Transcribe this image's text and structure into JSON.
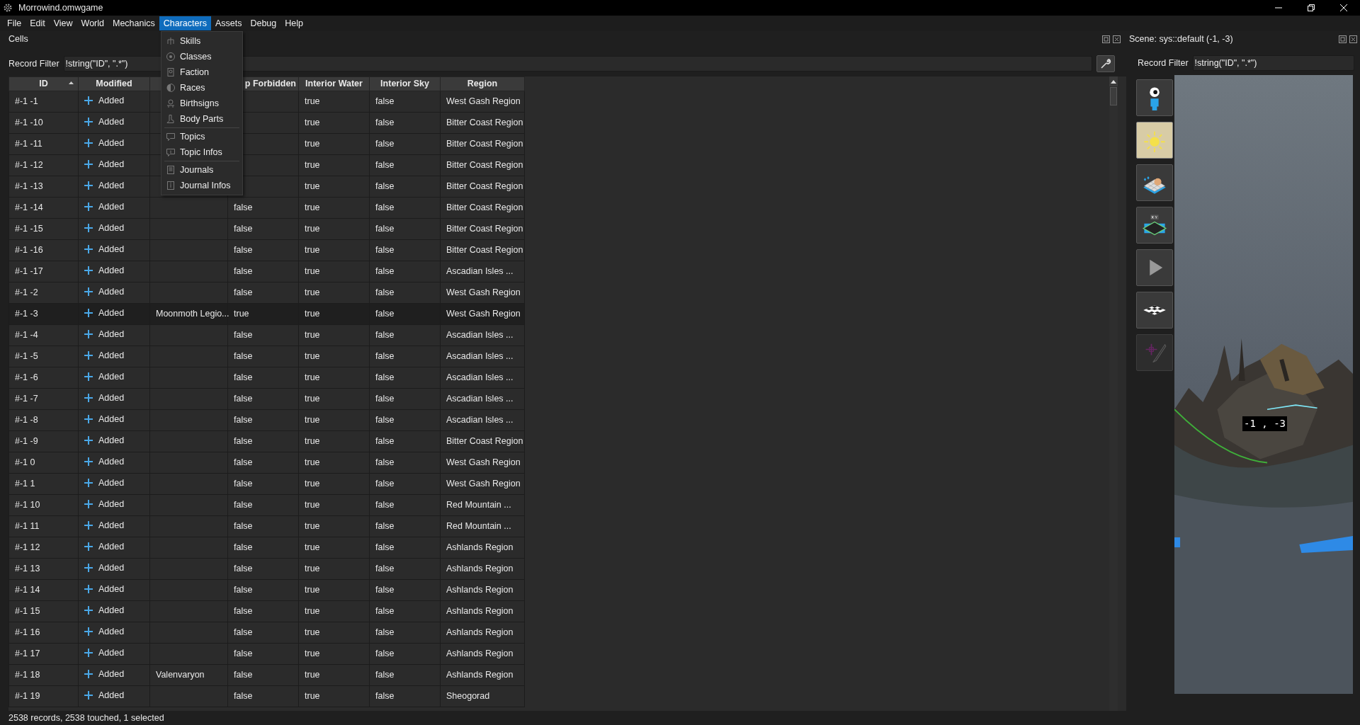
{
  "window": {
    "title": "Morrowind.omwgame"
  },
  "menu": [
    {
      "label": "File",
      "selected": false
    },
    {
      "label": "Edit",
      "selected": false
    },
    {
      "label": "View",
      "selected": false
    },
    {
      "label": "World",
      "selected": false
    },
    {
      "label": "Mechanics",
      "selected": false
    },
    {
      "label": "Characters",
      "selected": true
    },
    {
      "label": "Assets",
      "selected": false
    },
    {
      "label": "Debug",
      "selected": false
    },
    {
      "label": "Help",
      "selected": false
    }
  ],
  "dropdown": {
    "groups": [
      [
        "Skills",
        "Classes",
        "Faction",
        "Races",
        "Birthsigns",
        "Body Parts"
      ],
      [
        "Topics",
        "Topic Infos"
      ],
      [
        "Journals",
        "Journal Infos"
      ]
    ]
  },
  "cells_panel": {
    "title": "Cells",
    "filter_label": "Record Filter",
    "filter_value": "!string(\"ID\", \".*\")",
    "table": {
      "columns": [
        {
          "label": "ID",
          "sorted": true
        },
        {
          "label": "Modified",
          "sorted": false
        },
        {},
        {
          "label": "p Forbidden",
          "sorted": false
        },
        {
          "label": "Interior Water",
          "sorted": false
        },
        {
          "label": "Interior Sky",
          "sorted": false
        },
        {
          "label": "Region",
          "sorted": false
        }
      ],
      "rows": [
        {
          "id": "#-1 -1",
          "modified": "Added",
          "water": "true",
          "sky": "false",
          "region": "West Gash Region",
          "selected": false
        },
        {
          "id": "#-1 -10",
          "modified": "Added",
          "water": "true",
          "sky": "false",
          "region": "Bitter Coast Region",
          "selected": false
        },
        {
          "id": "#-1 -11",
          "modified": "Added",
          "water": "true",
          "sky": "false",
          "region": "Bitter Coast Region",
          "selected": false
        },
        {
          "id": "#-1 -12",
          "modified": "Added",
          "water": "true",
          "sky": "false",
          "region": "Bitter Coast Region",
          "selected": false
        },
        {
          "id": "#-1 -13",
          "modified": "Added",
          "water": "true",
          "sky": "false",
          "region": "Bitter Coast Region",
          "selected": false
        },
        {
          "id": "#-1 -14",
          "modified": "Added",
          "column_4": "false",
          "water": "true",
          "sky": "false",
          "region": "Bitter Coast Region",
          "selected": false
        },
        {
          "id": "#-1 -15",
          "modified": "Added",
          "column_4": "false",
          "water": "true",
          "sky": "false",
          "region": "Bitter Coast Region",
          "selected": false
        },
        {
          "id": "#-1 -16",
          "modified": "Added",
          "column_4": "false",
          "water": "true",
          "sky": "false",
          "region": "Bitter Coast Region",
          "selected": false
        },
        {
          "id": "#-1 -17",
          "modified": "Added",
          "column_4": "false",
          "water": "true",
          "sky": "false",
          "region": "Ascadian Isles ...",
          "selected": false
        },
        {
          "id": "#-1 -2",
          "modified": "Added",
          "column_4": "false",
          "water": "true",
          "sky": "false",
          "region": "West Gash Region",
          "selected": false
        },
        {
          "id": "#-1 -3",
          "modified": "Added",
          "column_3": "Moonmoth Legio...",
          "column_4": "true",
          "water": "true",
          "sky": "false",
          "region": "West Gash Region",
          "selected": true
        },
        {
          "id": "#-1 -4",
          "modified": "Added",
          "column_4": "false",
          "water": "true",
          "sky": "false",
          "region": "Ascadian Isles ...",
          "selected": false
        },
        {
          "id": "#-1 -5",
          "modified": "Added",
          "column_4": "false",
          "water": "true",
          "sky": "false",
          "region": "Ascadian Isles ...",
          "selected": false
        },
        {
          "id": "#-1 -6",
          "modified": "Added",
          "column_4": "false",
          "water": "true",
          "sky": "false",
          "region": "Ascadian Isles ...",
          "selected": false
        },
        {
          "id": "#-1 -7",
          "modified": "Added",
          "column_4": "false",
          "water": "true",
          "sky": "false",
          "region": "Ascadian Isles ...",
          "selected": false
        },
        {
          "id": "#-1 -8",
          "modified": "Added",
          "column_4": "false",
          "water": "true",
          "sky": "false",
          "region": "Ascadian Isles ...",
          "selected": false
        },
        {
          "id": "#-1 -9",
          "modified": "Added",
          "column_4": "false",
          "water": "true",
          "sky": "false",
          "region": "Bitter Coast Region",
          "selected": false
        },
        {
          "id": "#-1 0",
          "modified": "Added",
          "column_4": "false",
          "water": "true",
          "sky": "false",
          "region": "West Gash Region",
          "selected": false
        },
        {
          "id": "#-1 1",
          "modified": "Added",
          "column_4": "false",
          "water": "true",
          "sky": "false",
          "region": "West Gash Region",
          "selected": false
        },
        {
          "id": "#-1 10",
          "modified": "Added",
          "column_4": "false",
          "water": "true",
          "sky": "false",
          "region": "Red Mountain ...",
          "selected": false
        },
        {
          "id": "#-1 11",
          "modified": "Added",
          "column_4": "false",
          "water": "true",
          "sky": "false",
          "region": "Red Mountain ...",
          "selected": false
        },
        {
          "id": "#-1 12",
          "modified": "Added",
          "column_4": "false",
          "water": "true",
          "sky": "false",
          "region": "Ashlands Region",
          "selected": false
        },
        {
          "id": "#-1 13",
          "modified": "Added",
          "column_4": "false",
          "water": "true",
          "sky": "false",
          "region": "Ashlands Region",
          "selected": false
        },
        {
          "id": "#-1 14",
          "modified": "Added",
          "column_4": "false",
          "water": "true",
          "sky": "false",
          "region": "Ashlands Region",
          "selected": false
        },
        {
          "id": "#-1 15",
          "modified": "Added",
          "column_4": "false",
          "water": "true",
          "sky": "false",
          "region": "Ashlands Region",
          "selected": false
        },
        {
          "id": "#-1 16",
          "modified": "Added",
          "column_4": "false",
          "water": "true",
          "sky": "false",
          "region": "Ashlands Region",
          "selected": false
        },
        {
          "id": "#-1 17",
          "modified": "Added",
          "column_4": "false",
          "water": "true",
          "sky": "false",
          "region": "Ashlands Region",
          "selected": false
        },
        {
          "id": "#-1 18",
          "modified": "Added",
          "column_3": "Valenvaryon",
          "column_4": "false",
          "water": "true",
          "sky": "false",
          "region": "Ashlands Region",
          "selected": false
        },
        {
          "id": "#-1 19",
          "modified": "Added",
          "column_4": "false",
          "water": "true",
          "sky": "false",
          "region": "Sheogorad",
          "selected": false
        }
      ]
    }
  },
  "scene_panel": {
    "title": "Scene: sys::default (-1, -3)",
    "filter_label": "Record Filter",
    "filter_value": "!string(\"ID\", \".*\")",
    "tools": [
      {
        "kind": "camera",
        "selected": false,
        "disabled": false
      },
      {
        "kind": "lighting",
        "selected": true,
        "disabled": false
      },
      {
        "kind": "terrain",
        "selected": false,
        "disabled": false
      },
      {
        "kind": "cell-grid",
        "selected": false,
        "disabled": false
      },
      {
        "kind": "play",
        "selected": false,
        "disabled": false
      },
      {
        "kind": "checker",
        "selected": false,
        "disabled": false
      },
      {
        "kind": "edit",
        "selected": false,
        "disabled": true
      }
    ],
    "view": {
      "kind": "picture",
      "cell_label": "-1 , -3"
    }
  },
  "status_bar": "2538 records, 2538 touched, 1 selected"
}
